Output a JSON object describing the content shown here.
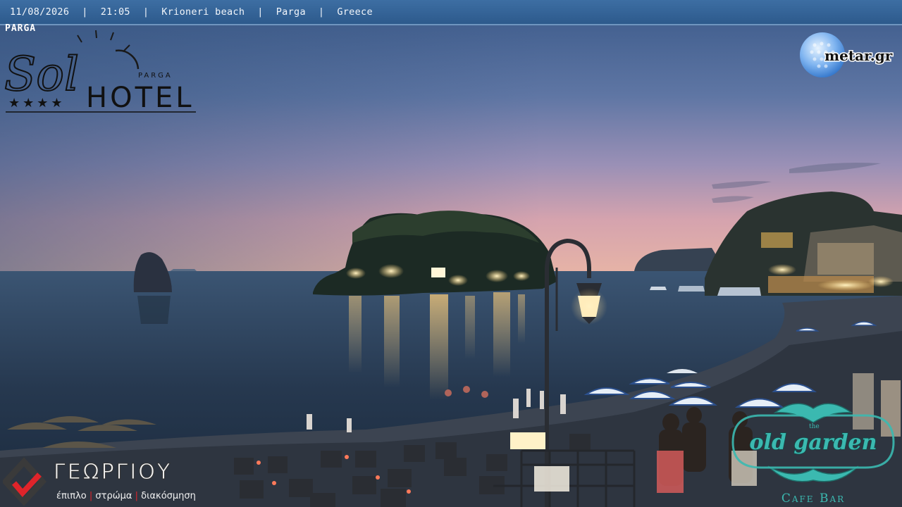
{
  "header": {
    "date": "11/08/2026",
    "time": "21:05",
    "location": "Krioneri beach",
    "town": "Parga",
    "country": "Greece",
    "separator": "|"
  },
  "overlay": {
    "parga_tag": "PARGA",
    "sol_hotel": {
      "main": "Sol",
      "sub": "HOTEL",
      "place": "PARGA",
      "stars": "★★★★"
    },
    "metar": "metar.gr",
    "georgiou": {
      "name": "ΓΕΩΡΓΙΟΥ",
      "tagline_1": "έπιπλο",
      "tagline_2": "στρώμα",
      "tagline_3": "διακόσμηση",
      "bar": "|"
    },
    "old_garden": {
      "the": "the",
      "name": "old garden",
      "sub": "Cafe Bar"
    }
  },
  "colors": {
    "header_bg": "#2d5a8c",
    "sky_top": "#3b5a8a",
    "sky_horizon": "#e6a9a6",
    "sea": "#22344a",
    "lights": "#ffd27a",
    "garden_teal": "#3bb9b0"
  }
}
